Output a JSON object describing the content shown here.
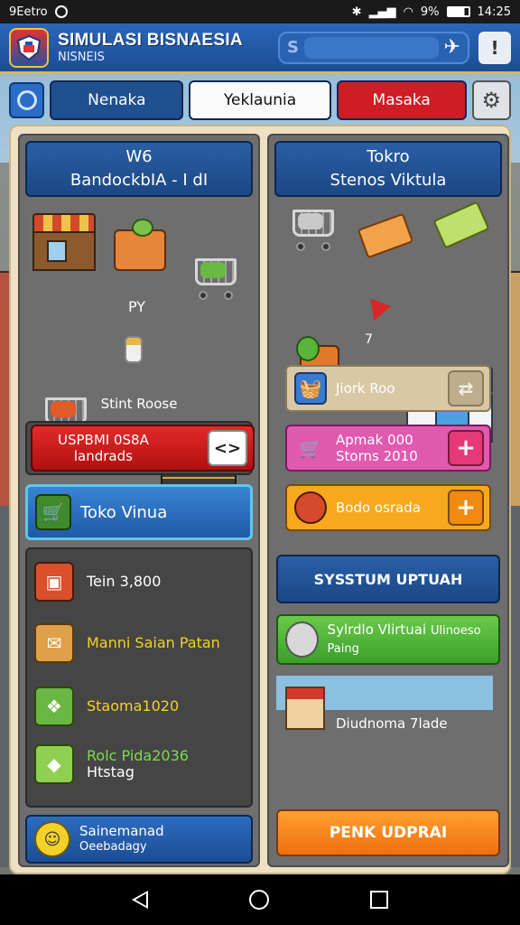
{
  "status_bar": {
    "carrier": "9Eetro",
    "battery_pct": "9%",
    "time": "14:25"
  },
  "header": {
    "title": "SIMULASI BISNAESIA",
    "subtitle": "NISNEIS",
    "search_glyph": "S",
    "info_label": "!"
  },
  "tabs": [
    "Nenaka",
    "Yeklaunia",
    "Masaka"
  ],
  "left": {
    "heading_line1": "W6",
    "heading_line2": "BandockbIA - I dI",
    "stage_note": "PY",
    "stage_label": "Stint Roose",
    "red_button_line1": "USPBMI 0S8A",
    "red_button_line2": "landrads",
    "red_button_arrow": "<>",
    "shop_button": "Toko Vinua",
    "stats": [
      {
        "line1": "Tein 3,800",
        "line2": "",
        "icon": "tablet-icon",
        "color": "white"
      },
      {
        "line1": "Manni Saian Patan",
        "line2": "",
        "icon": "scroll-icon",
        "color": "yellow"
      },
      {
        "line1": "Staoma1020",
        "line2": "",
        "icon": "gift-icon",
        "color": "yellow"
      },
      {
        "line1": "Rolc Pida2036",
        "line2": "Htstag",
        "icon": "crate-icon",
        "color": "green"
      }
    ],
    "bottom_line1": "Sainemanad",
    "bottom_line2": "Oeebadagy"
  },
  "right": {
    "heading_line1": "Tokro",
    "heading_line2": "Stenos Viktula",
    "stage_note": "7",
    "row1": "Jiork Roo",
    "row2_line1": "Apmak 000",
    "row2_line2": "Storns 2010",
    "row3": "Bodo osrada",
    "system_button": "SYSSTUM UPTUAH",
    "green_line1": "Sylrdlo Vlirtuai",
    "green_line2": "Ulinoeso Paing",
    "store_label": "Diudnoma 7lade",
    "orange_button": "PENK UDPRAI",
    "plus": "+",
    "swap": "⇄"
  }
}
